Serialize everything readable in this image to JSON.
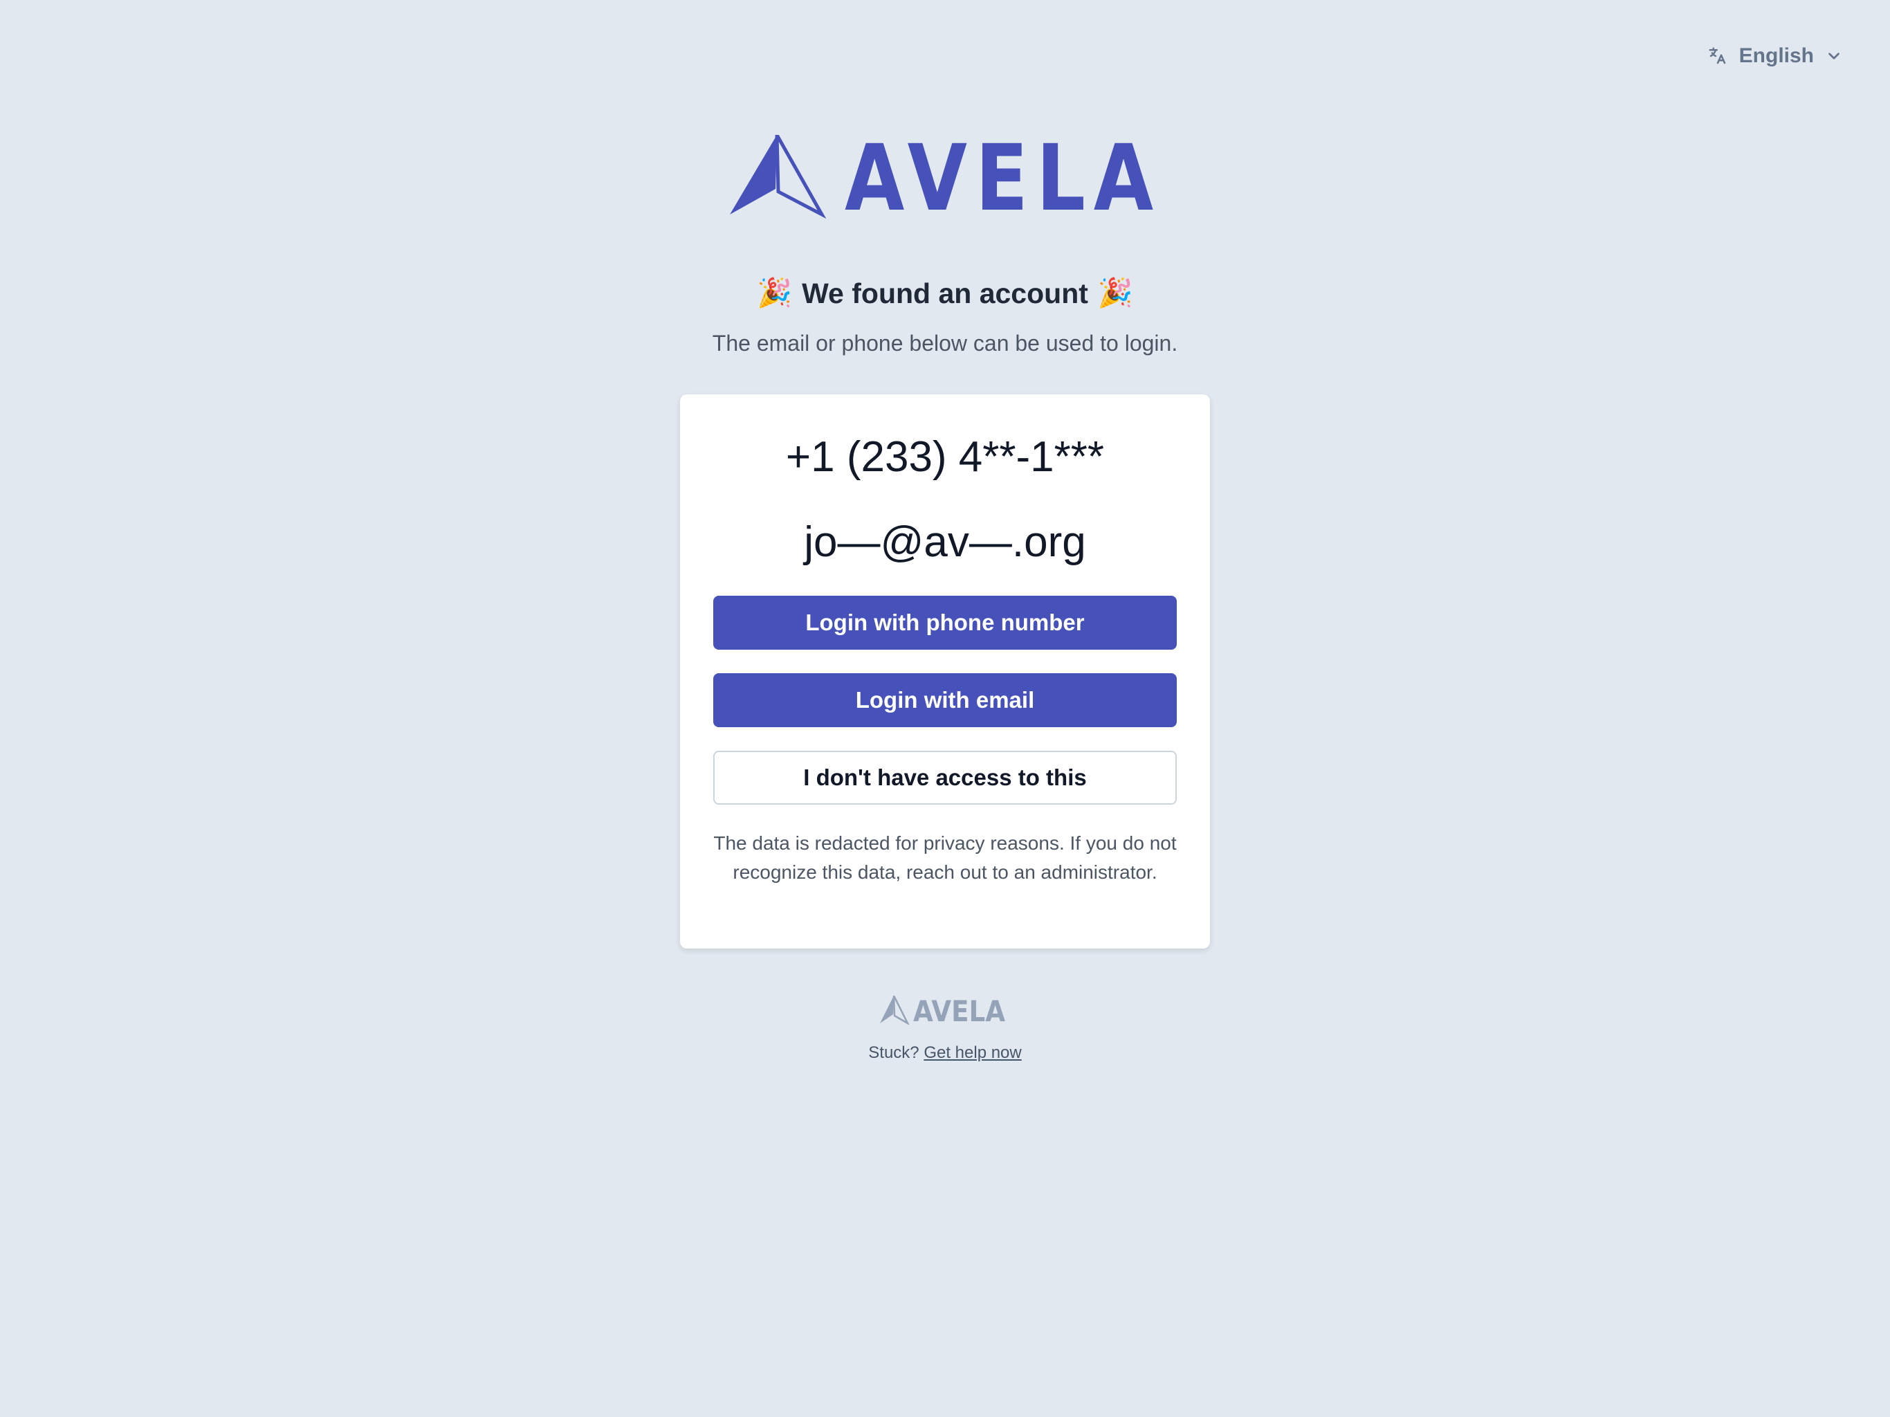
{
  "language": {
    "icon": "translate-icon",
    "label": "English",
    "chevron": "chevron-down-icon"
  },
  "brand": {
    "name": "AVELA",
    "color": "#4652b9",
    "footer_color": "#94a3b8"
  },
  "header": {
    "emoji": "🎉",
    "title": "We found an account",
    "subtitle": "The email or phone below can be used to login."
  },
  "account": {
    "phone": "+1 (233) 4**-1***",
    "email": "jo—@av—.org"
  },
  "actions": {
    "phone_login": "Login with phone number",
    "email_login": "Login with email",
    "no_access": "I don't have access to this"
  },
  "note": "The data is redacted for privacy reasons. If you do not recognize this data, reach out to an administrator.",
  "footer": {
    "stuck": "Stuck?",
    "help_link": "Get help now"
  },
  "colors": {
    "background": "#e2e8f0",
    "primary_button": "#4652b9",
    "card": "#ffffff"
  }
}
